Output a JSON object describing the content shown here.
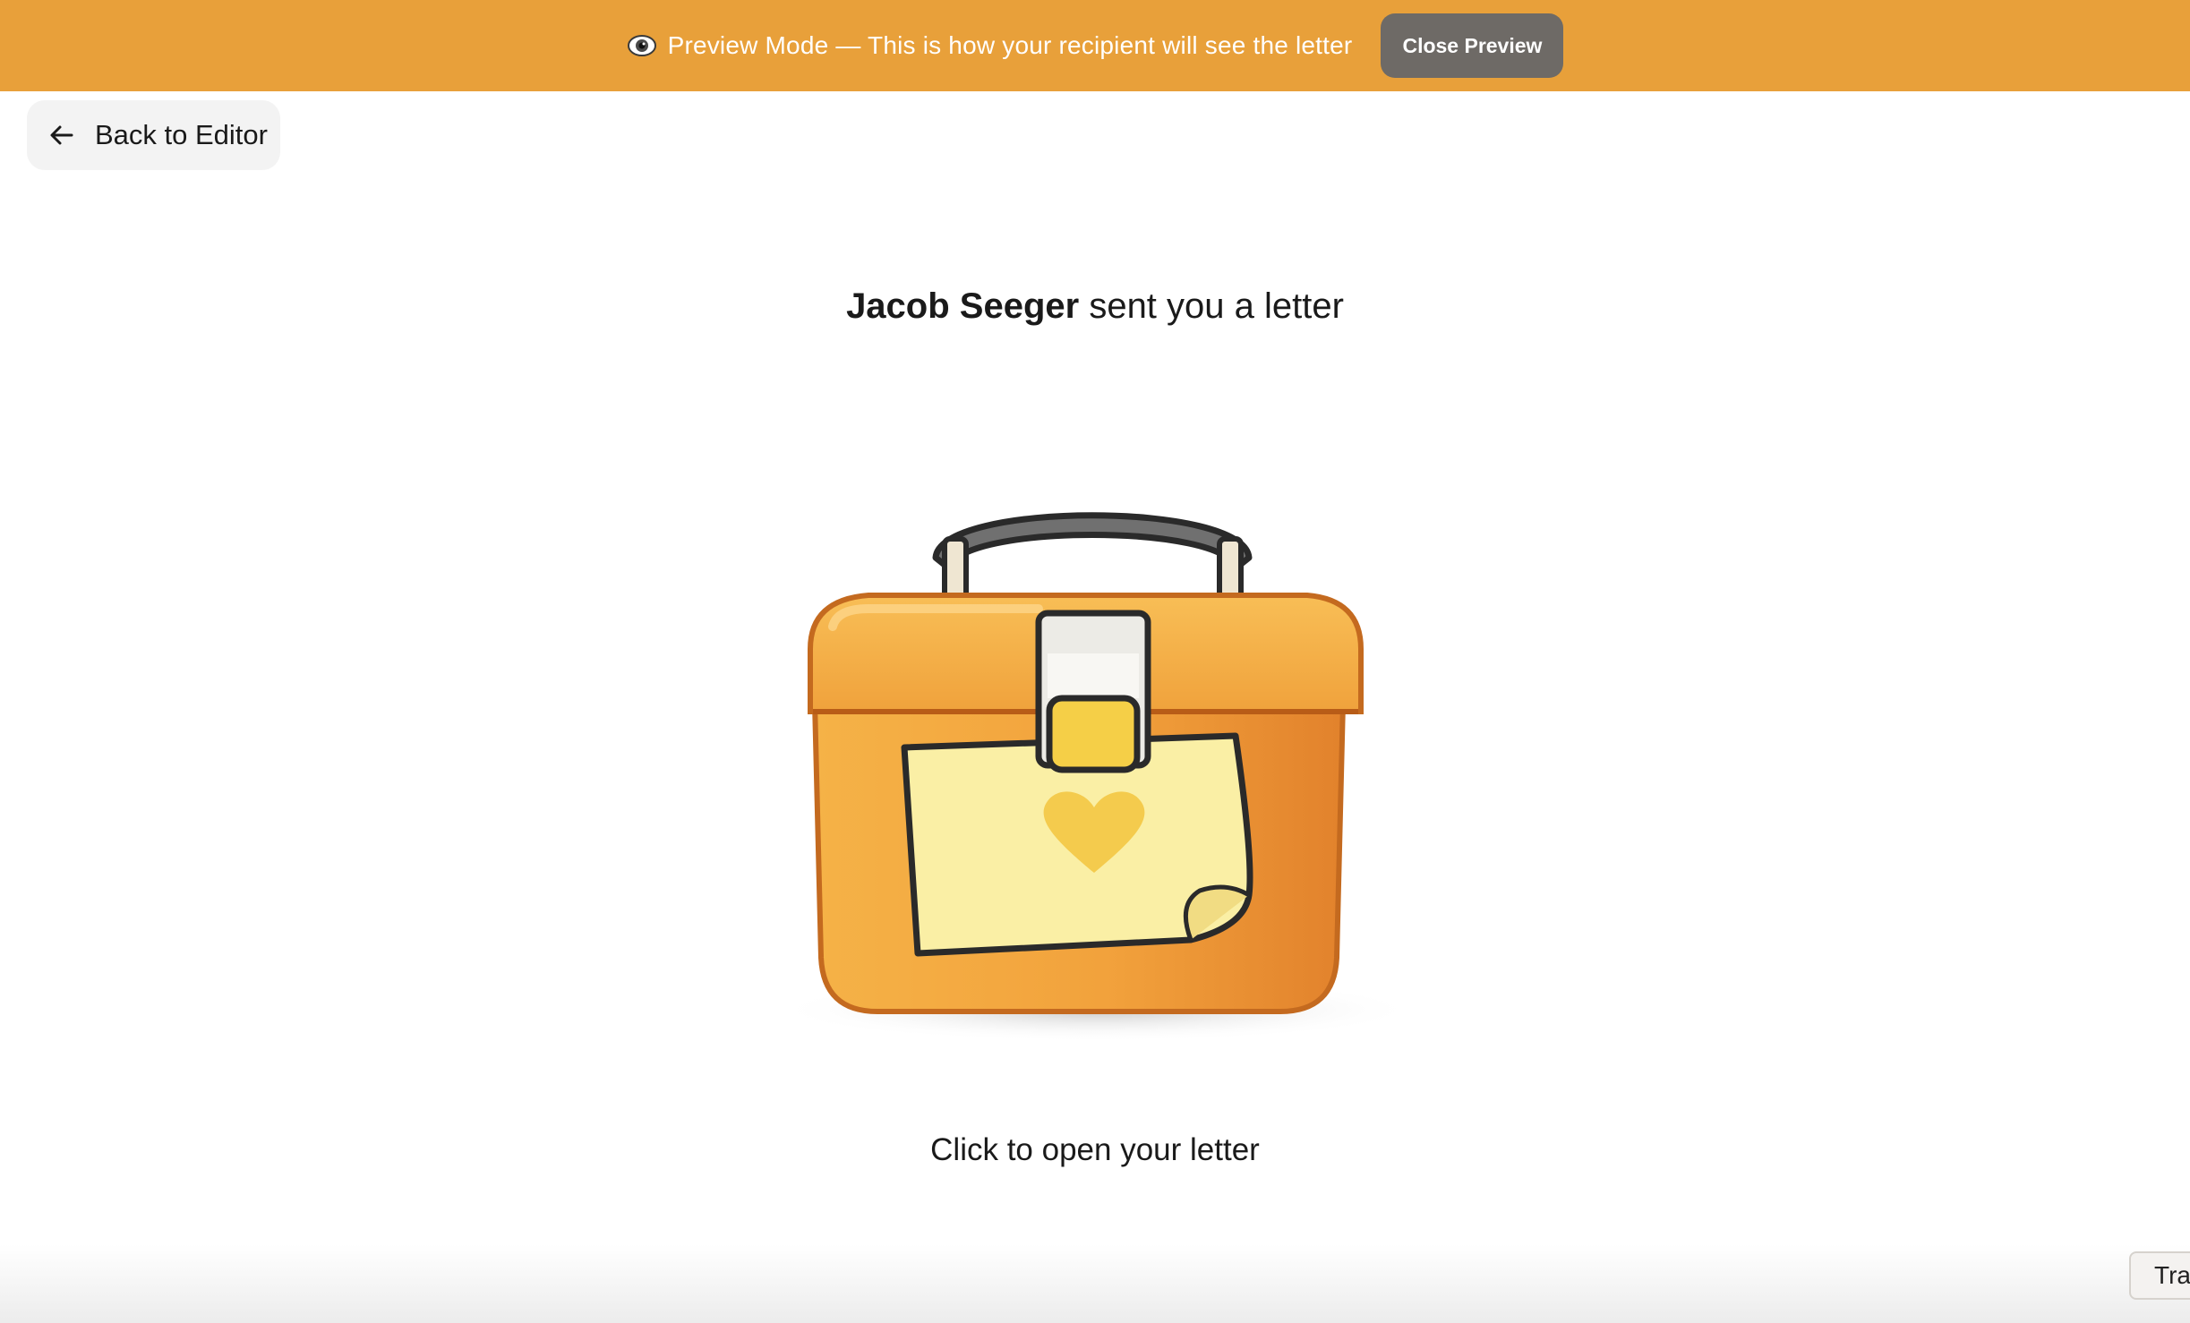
{
  "banner": {
    "icon": "eye-icon",
    "message": "Preview Mode — This is how your recipient will see the letter",
    "close_label": "Close Preview",
    "background": "#e8a03a",
    "button_color": "#6e6a66"
  },
  "nav": {
    "back_label": "Back to Editor",
    "back_icon": "arrow-left-icon"
  },
  "letter": {
    "sender": "Jacob Seeger",
    "sender_suffix": " sent you a letter",
    "illustration": "lunchbox-with-heart-note",
    "cta": "Click to open your letter"
  },
  "corner": {
    "label": "Tra"
  }
}
